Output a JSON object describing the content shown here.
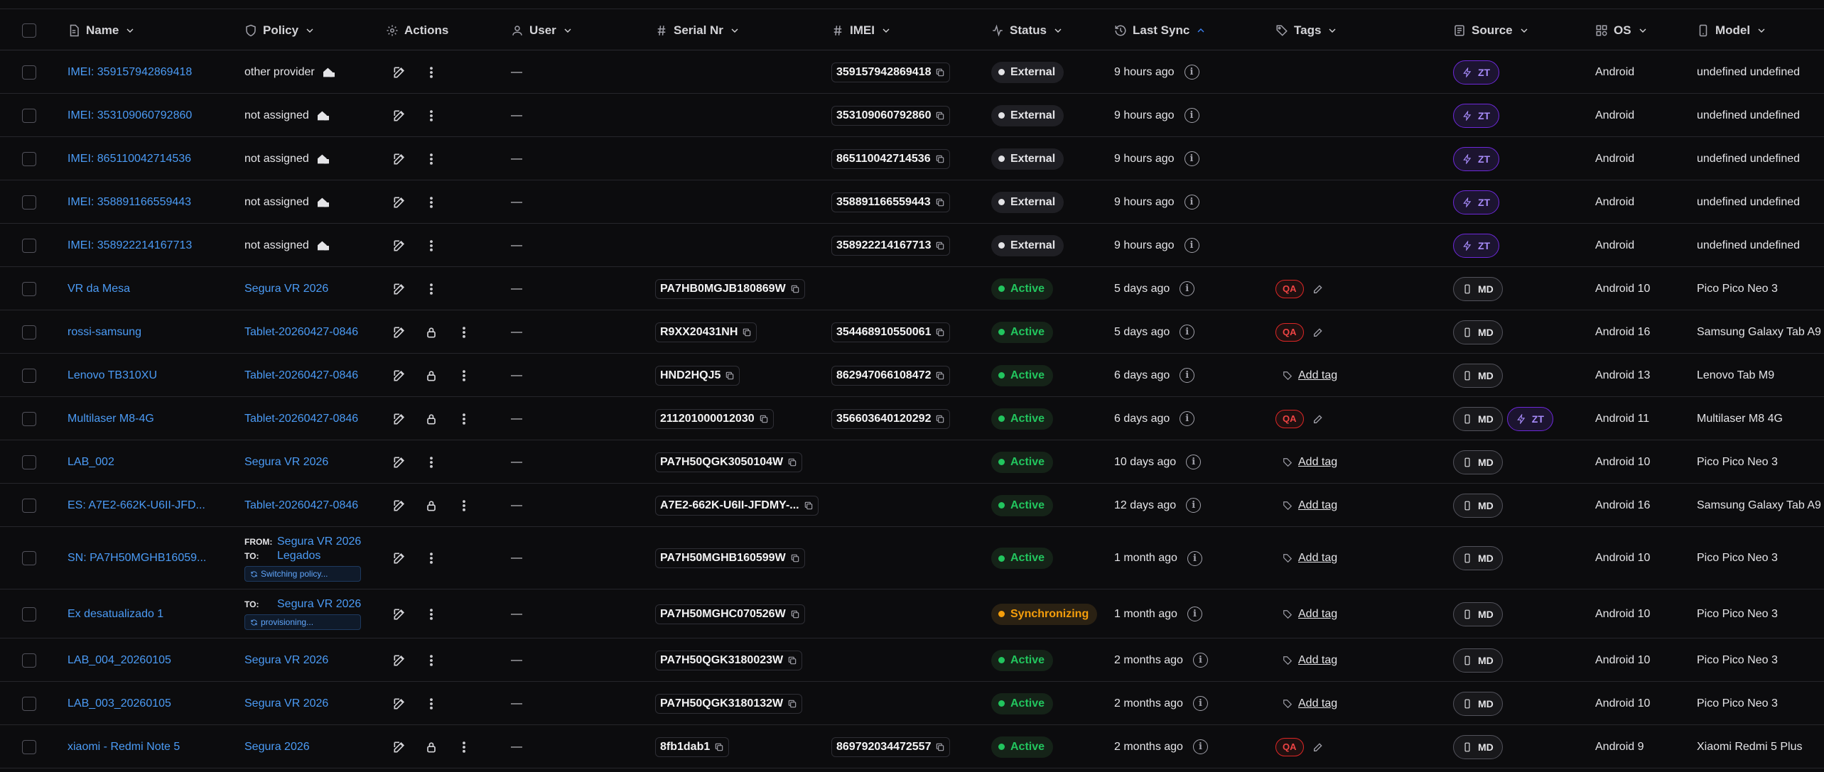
{
  "columns": {
    "name": "Name",
    "policy": "Policy",
    "actions": "Actions",
    "user": "User",
    "serial": "Serial Nr",
    "imei": "IMEI",
    "status": "Status",
    "last_sync": "Last Sync",
    "tags": "Tags",
    "source": "Source",
    "os": "OS",
    "model": "Model"
  },
  "labels": {
    "from": "FROM:",
    "to": "TO:",
    "add_tag": "Add tag",
    "qa": "QA",
    "md": "MD",
    "zt": "ZT",
    "dash": "—"
  },
  "colors": {
    "link": "#4b9bf5",
    "active": "#22c55e",
    "sync": "#f59e0b",
    "zt": "#a78bfa",
    "qa": "#ef4444"
  },
  "rows": [
    {
      "name": "IMEI: 359157942869418",
      "policy": "other provider",
      "policy_link": false,
      "policy_icon": "external-provider-icon",
      "lock": false,
      "serial": "",
      "imei": "359157942869418",
      "status": "External",
      "status_kind": "external",
      "sync": "9 hours ago",
      "tags": "",
      "sources": [
        "zt"
      ],
      "os": "Android",
      "model": "undefined undefined"
    },
    {
      "name": "IMEI: 353109060792860",
      "policy": "not assigned",
      "policy_link": false,
      "policy_icon": "external-provider-icon",
      "lock": false,
      "serial": "",
      "imei": "353109060792860",
      "status": "External",
      "status_kind": "external",
      "sync": "9 hours ago",
      "tags": "",
      "sources": [
        "zt"
      ],
      "os": "Android",
      "model": "undefined undefined"
    },
    {
      "name": "IMEI: 865110042714536",
      "policy": "not assigned",
      "policy_link": false,
      "policy_icon": "external-provider-icon",
      "lock": false,
      "serial": "",
      "imei": "865110042714536",
      "status": "External",
      "status_kind": "external",
      "sync": "9 hours ago",
      "tags": "",
      "sources": [
        "zt"
      ],
      "os": "Android",
      "model": "undefined undefined"
    },
    {
      "name": "IMEI: 358891166559443",
      "policy": "not assigned",
      "policy_link": false,
      "policy_icon": "external-provider-icon",
      "lock": false,
      "serial": "",
      "imei": "358891166559443",
      "status": "External",
      "status_kind": "external",
      "sync": "9 hours ago",
      "tags": "",
      "sources": [
        "zt"
      ],
      "os": "Android",
      "model": "undefined undefined"
    },
    {
      "name": "IMEI: 358922214167713",
      "policy": "not assigned",
      "policy_link": false,
      "policy_icon": "external-provider-icon",
      "lock": false,
      "serial": "",
      "imei": "358922214167713",
      "status": "External",
      "status_kind": "external",
      "sync": "9 hours ago",
      "tags": "",
      "sources": [
        "zt"
      ],
      "os": "Android",
      "model": "undefined undefined"
    },
    {
      "name": "VR da Mesa",
      "policy": "Segura VR 2026",
      "policy_link": true,
      "lock": false,
      "serial": "PA7HB0MGJB180869W",
      "imei": "",
      "status": "Active",
      "status_kind": "active",
      "sync": "5 days ago",
      "tags": "qa",
      "sources": [
        "md"
      ],
      "os": "Android 10",
      "model": "Pico Pico Neo 3"
    },
    {
      "name": "rossi-samsung",
      "policy": "Tablet-20260427-0846",
      "policy_link": true,
      "lock": true,
      "serial": "R9XX20431NH",
      "imei": "354468910550061",
      "status": "Active",
      "status_kind": "active",
      "sync": "5 days ago",
      "tags": "qa",
      "sources": [
        "md"
      ],
      "os": "Android 16",
      "model": "Samsung Galaxy Tab A9"
    },
    {
      "name": "Lenovo TB310XU",
      "policy": "Tablet-20260427-0846",
      "policy_link": true,
      "lock": true,
      "serial": "HND2HQJ5",
      "imei": "862947066108472",
      "status": "Active",
      "status_kind": "active",
      "sync": "6 days ago",
      "tags": "add",
      "sources": [
        "md"
      ],
      "os": "Android 13",
      "model": "Lenovo Tab M9"
    },
    {
      "name": "Multilaser M8-4G",
      "policy": "Tablet-20260427-0846",
      "policy_link": true,
      "lock": true,
      "serial": "211201000012030",
      "imei": "356603640120292",
      "status": "Active",
      "status_kind": "active",
      "sync": "6 days ago",
      "tags": "qa",
      "sources": [
        "md",
        "zt"
      ],
      "os": "Android 11",
      "model": "Multilaser M8 4G"
    },
    {
      "name": "LAB_002",
      "policy": "Segura VR 2026",
      "policy_link": true,
      "lock": false,
      "serial": "PA7H50QGK3050104W",
      "imei": "",
      "status": "Active",
      "status_kind": "active",
      "sync": "10 days ago",
      "tags": "add",
      "sources": [
        "md"
      ],
      "os": "Android 10",
      "model": "Pico Pico Neo 3"
    },
    {
      "name": "ES: A7E2-662K-U6II-JFD...",
      "policy": "Tablet-20260427-0846",
      "policy_link": true,
      "lock": true,
      "serial": "A7E2-662K-U6II-JFDMY-...",
      "imei": "",
      "status": "Active",
      "status_kind": "active",
      "sync": "12 days ago",
      "tags": "add",
      "sources": [
        "md"
      ],
      "os": "Android 16",
      "model": "Samsung Galaxy Tab A9"
    },
    {
      "name": "SN: PA7H50MGHB16059...",
      "policy_from": "Segura VR 2026",
      "policy_to": "Legados",
      "policy_tag": "Switching policy...",
      "lock": false,
      "serial": "PA7H50MGHB160599W",
      "imei": "",
      "status": "Active",
      "status_kind": "active",
      "sync": "1 month ago",
      "tags": "add",
      "sources": [
        "md"
      ],
      "os": "Android 10",
      "model": "Pico Pico Neo 3"
    },
    {
      "name": "Ex desatualizado 1",
      "policy_to": "Segura VR 2026",
      "policy_tag": "provisioning...",
      "lock": false,
      "serial": "PA7H50MGHC070526W",
      "imei": "",
      "status": "Synchronizing",
      "status_kind": "sync",
      "sync": "1 month ago",
      "tags": "add",
      "sources": [
        "md"
      ],
      "os": "Android 10",
      "model": "Pico Pico Neo 3"
    },
    {
      "name": "LAB_004_20260105",
      "policy": "Segura VR 2026",
      "policy_link": true,
      "lock": false,
      "serial": "PA7H50QGK3180023W",
      "imei": "",
      "status": "Active",
      "status_kind": "active",
      "sync": "2 months ago",
      "tags": "add",
      "sources": [
        "md"
      ],
      "os": "Android 10",
      "model": "Pico Pico Neo 3"
    },
    {
      "name": "LAB_003_20260105",
      "policy": "Segura VR 2026",
      "policy_link": true,
      "lock": false,
      "serial": "PA7H50QGK3180132W",
      "imei": "",
      "status": "Active",
      "status_kind": "active",
      "sync": "2 months ago",
      "tags": "add",
      "sources": [
        "md"
      ],
      "os": "Android 10",
      "model": "Pico Pico Neo 3"
    },
    {
      "name": "xiaomi - Redmi Note 5",
      "policy": "Segura 2026",
      "policy_link": true,
      "lock": true,
      "serial": "8fb1dab1",
      "imei": "869792034472557",
      "status": "Active",
      "status_kind": "active",
      "sync": "2 months ago",
      "tags": "qa",
      "sources": [
        "md"
      ],
      "os": "Android 9",
      "model": "Xiaomi Redmi 5 Plus"
    }
  ]
}
